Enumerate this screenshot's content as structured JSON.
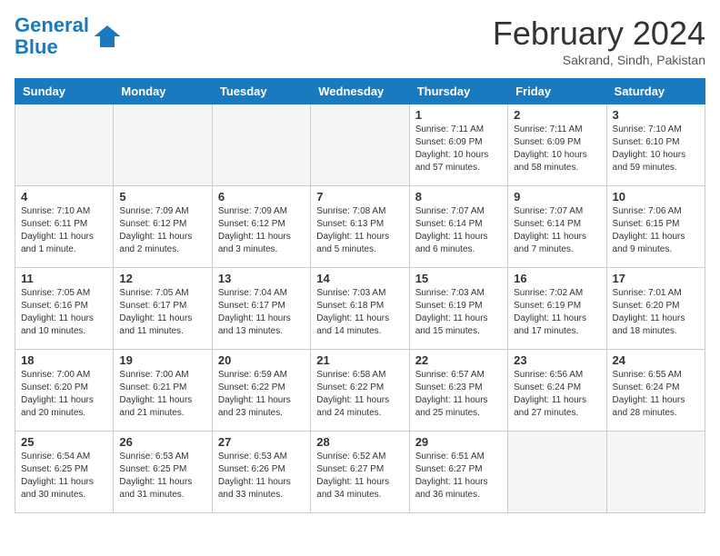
{
  "header": {
    "logo_line1": "General",
    "logo_line2": "Blue",
    "month_title": "February 2024",
    "location": "Sakrand, Sindh, Pakistan"
  },
  "weekdays": [
    "Sunday",
    "Monday",
    "Tuesday",
    "Wednesday",
    "Thursday",
    "Friday",
    "Saturday"
  ],
  "weeks": [
    [
      {
        "day": "",
        "info": ""
      },
      {
        "day": "",
        "info": ""
      },
      {
        "day": "",
        "info": ""
      },
      {
        "day": "",
        "info": ""
      },
      {
        "day": "1",
        "info": "Sunrise: 7:11 AM\nSunset: 6:09 PM\nDaylight: 10 hours\nand 57 minutes."
      },
      {
        "day": "2",
        "info": "Sunrise: 7:11 AM\nSunset: 6:09 PM\nDaylight: 10 hours\nand 58 minutes."
      },
      {
        "day": "3",
        "info": "Sunrise: 7:10 AM\nSunset: 6:10 PM\nDaylight: 10 hours\nand 59 minutes."
      }
    ],
    [
      {
        "day": "4",
        "info": "Sunrise: 7:10 AM\nSunset: 6:11 PM\nDaylight: 11 hours\nand 1 minute."
      },
      {
        "day": "5",
        "info": "Sunrise: 7:09 AM\nSunset: 6:12 PM\nDaylight: 11 hours\nand 2 minutes."
      },
      {
        "day": "6",
        "info": "Sunrise: 7:09 AM\nSunset: 6:12 PM\nDaylight: 11 hours\nand 3 minutes."
      },
      {
        "day": "7",
        "info": "Sunrise: 7:08 AM\nSunset: 6:13 PM\nDaylight: 11 hours\nand 5 minutes."
      },
      {
        "day": "8",
        "info": "Sunrise: 7:07 AM\nSunset: 6:14 PM\nDaylight: 11 hours\nand 6 minutes."
      },
      {
        "day": "9",
        "info": "Sunrise: 7:07 AM\nSunset: 6:14 PM\nDaylight: 11 hours\nand 7 minutes."
      },
      {
        "day": "10",
        "info": "Sunrise: 7:06 AM\nSunset: 6:15 PM\nDaylight: 11 hours\nand 9 minutes."
      }
    ],
    [
      {
        "day": "11",
        "info": "Sunrise: 7:05 AM\nSunset: 6:16 PM\nDaylight: 11 hours\nand 10 minutes."
      },
      {
        "day": "12",
        "info": "Sunrise: 7:05 AM\nSunset: 6:17 PM\nDaylight: 11 hours\nand 11 minutes."
      },
      {
        "day": "13",
        "info": "Sunrise: 7:04 AM\nSunset: 6:17 PM\nDaylight: 11 hours\nand 13 minutes."
      },
      {
        "day": "14",
        "info": "Sunrise: 7:03 AM\nSunset: 6:18 PM\nDaylight: 11 hours\nand 14 minutes."
      },
      {
        "day": "15",
        "info": "Sunrise: 7:03 AM\nSunset: 6:19 PM\nDaylight: 11 hours\nand 15 minutes."
      },
      {
        "day": "16",
        "info": "Sunrise: 7:02 AM\nSunset: 6:19 PM\nDaylight: 11 hours\nand 17 minutes."
      },
      {
        "day": "17",
        "info": "Sunrise: 7:01 AM\nSunset: 6:20 PM\nDaylight: 11 hours\nand 18 minutes."
      }
    ],
    [
      {
        "day": "18",
        "info": "Sunrise: 7:00 AM\nSunset: 6:20 PM\nDaylight: 11 hours\nand 20 minutes."
      },
      {
        "day": "19",
        "info": "Sunrise: 7:00 AM\nSunset: 6:21 PM\nDaylight: 11 hours\nand 21 minutes."
      },
      {
        "day": "20",
        "info": "Sunrise: 6:59 AM\nSunset: 6:22 PM\nDaylight: 11 hours\nand 23 minutes."
      },
      {
        "day": "21",
        "info": "Sunrise: 6:58 AM\nSunset: 6:22 PM\nDaylight: 11 hours\nand 24 minutes."
      },
      {
        "day": "22",
        "info": "Sunrise: 6:57 AM\nSunset: 6:23 PM\nDaylight: 11 hours\nand 25 minutes."
      },
      {
        "day": "23",
        "info": "Sunrise: 6:56 AM\nSunset: 6:24 PM\nDaylight: 11 hours\nand 27 minutes."
      },
      {
        "day": "24",
        "info": "Sunrise: 6:55 AM\nSunset: 6:24 PM\nDaylight: 11 hours\nand 28 minutes."
      }
    ],
    [
      {
        "day": "25",
        "info": "Sunrise: 6:54 AM\nSunset: 6:25 PM\nDaylight: 11 hours\nand 30 minutes."
      },
      {
        "day": "26",
        "info": "Sunrise: 6:53 AM\nSunset: 6:25 PM\nDaylight: 11 hours\nand 31 minutes."
      },
      {
        "day": "27",
        "info": "Sunrise: 6:53 AM\nSunset: 6:26 PM\nDaylight: 11 hours\nand 33 minutes."
      },
      {
        "day": "28",
        "info": "Sunrise: 6:52 AM\nSunset: 6:27 PM\nDaylight: 11 hours\nand 34 minutes."
      },
      {
        "day": "29",
        "info": "Sunrise: 6:51 AM\nSunset: 6:27 PM\nDaylight: 11 hours\nand 36 minutes."
      },
      {
        "day": "",
        "info": ""
      },
      {
        "day": "",
        "info": ""
      }
    ]
  ]
}
